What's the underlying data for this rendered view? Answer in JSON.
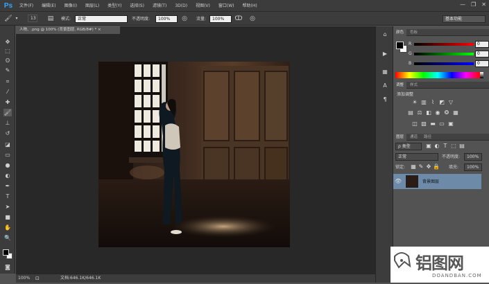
{
  "app": {
    "logo": "Ps"
  },
  "menu": [
    "文件(F)",
    "编辑(E)",
    "图像(I)",
    "图层(L)",
    "类型(Y)",
    "选择(S)",
    "滤镜(T)",
    "3D(D)",
    "视图(V)",
    "窗口(W)",
    "帮助(H)"
  ],
  "window_buttons": [
    "—",
    "❐",
    "✕"
  ],
  "options": {
    "brush_size": "13",
    "mode_label": "模式:",
    "mode_value": "正常",
    "opacity_label": "不透明度:",
    "opacity_value": "100%",
    "flow_label": "流量:",
    "flow_value": "100%",
    "workspace_value": "基本功能"
  },
  "document": {
    "tab_title": "人物、.png @ 100% (背景图层, RGB/8#) * ×",
    "zoom": "100%",
    "doc_info": "文档:646.1K/646.1K"
  },
  "color_panel": {
    "tabs": [
      "颜色",
      "色板"
    ],
    "sliders": [
      {
        "letter": "R",
        "value": "0"
      },
      {
        "letter": "G",
        "value": "0"
      },
      {
        "letter": "B",
        "value": "0"
      }
    ]
  },
  "adjustments_panel": {
    "tabs": [
      "调整",
      "样式"
    ],
    "heading": "添加调整"
  },
  "layers_panel": {
    "tabs": [
      "图层",
      "通道",
      "路径"
    ],
    "filter_label": "ρ 类型",
    "blend_mode": "正常",
    "opacity_label": "不透明度:",
    "opacity_value": "100%",
    "lock_label": "锁定:",
    "fill_label": "填充:",
    "fill_value": "100%",
    "layers": [
      {
        "name": "背景图层",
        "visible": true
      }
    ]
  },
  "watermark": {
    "text": "铝图网",
    "sub": "DOANDBAN.COM"
  }
}
